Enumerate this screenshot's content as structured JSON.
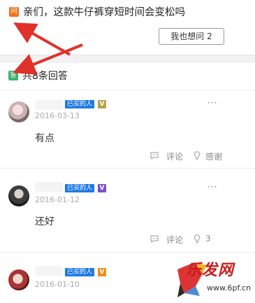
{
  "question": {
    "badge": "问",
    "text": "亲们，这款牛仔裤穿短时间会变松吗",
    "ask_button": "我也想问 2"
  },
  "answers_header": {
    "badge": "答",
    "count_label": "共8条回答"
  },
  "answers": [
    {
      "bought_label": "已买的人",
      "vip_badge": "V",
      "date": "2016-03-13",
      "text": "有点",
      "more": "···",
      "comment_label": "评论",
      "like_label": "感谢"
    },
    {
      "bought_label": "已买的人",
      "vip_badge": "V",
      "date": "2016-01-12",
      "text": "还好",
      "more": "···",
      "comment_label": "评论",
      "like_label": "3"
    },
    {
      "bought_label": "已买的人",
      "vip_badge": "V",
      "date": "2016-01-10",
      "more": "···"
    }
  ],
  "watermark": {
    "text": "乐发网",
    "url": "www.6pf.cn"
  },
  "colors": {
    "question_badge": "#f2711c",
    "answer_badge": "#3cb371",
    "bought_badge": "#1e7ae6",
    "arrow": "#e0312b",
    "watermark": "#c71f1f"
  }
}
